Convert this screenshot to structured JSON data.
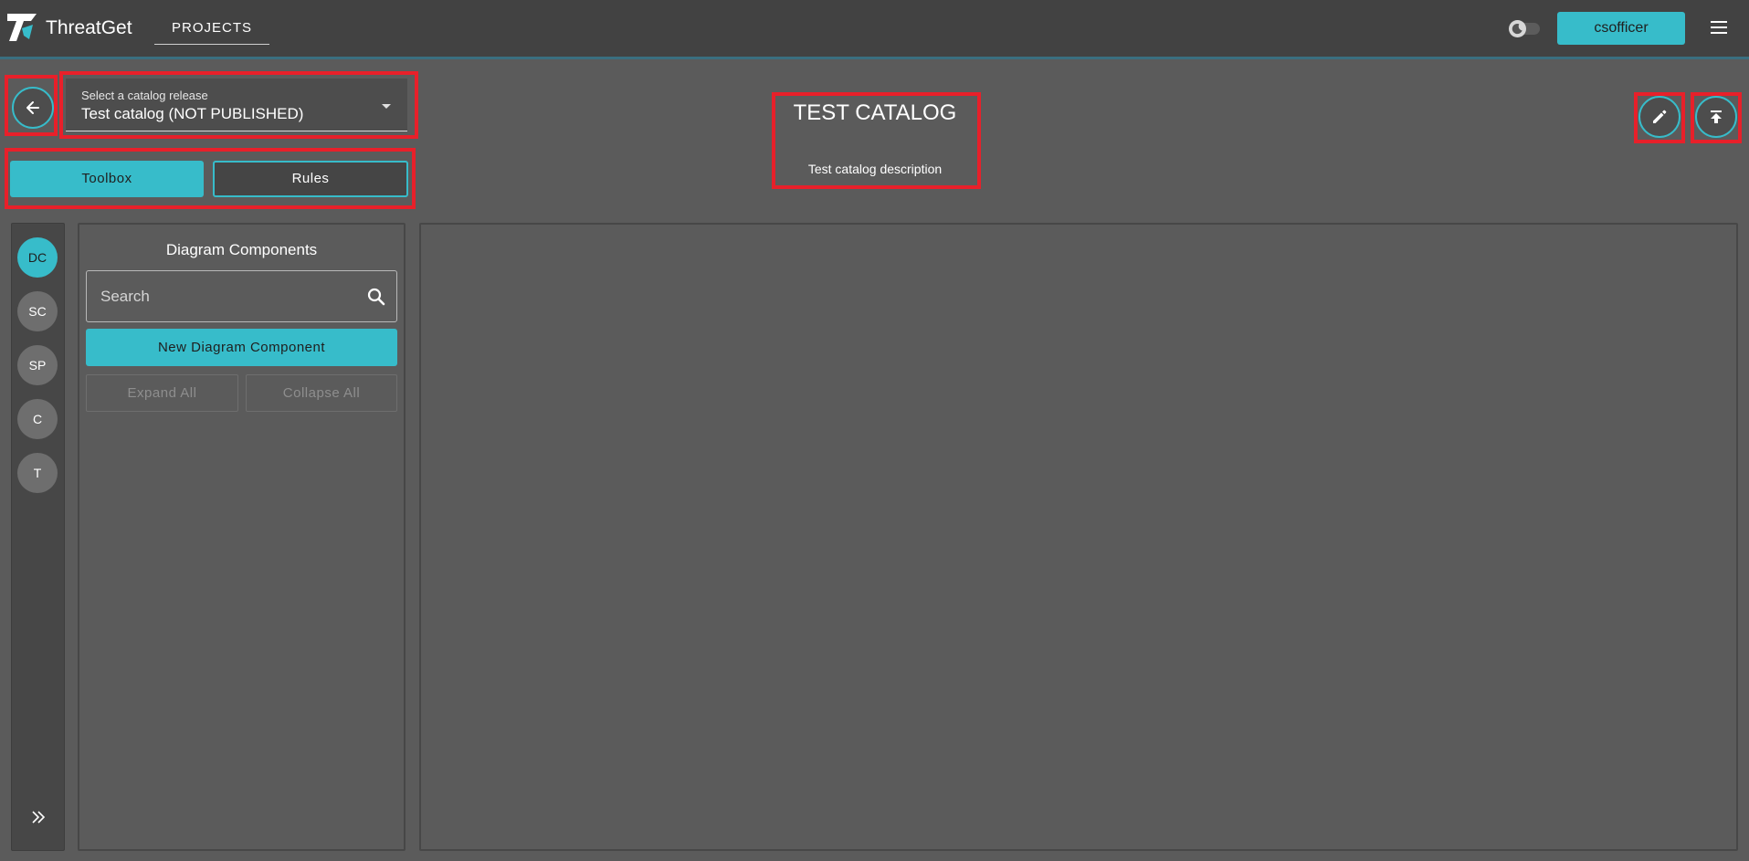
{
  "header": {
    "app_title": "ThreatGet",
    "nav_projects": "PROJECTS",
    "user_button": "csofficer",
    "icons": {
      "logo": "threatget-logo-icon",
      "theme": "moon-icon",
      "menu": "hamburger-menu-icon"
    }
  },
  "catalog_select": {
    "label": "Select a catalog release",
    "value": "Test catalog (NOT PUBLISHED)"
  },
  "tabs": {
    "toolbox": "Toolbox",
    "rules": "Rules"
  },
  "catalog": {
    "title": "TEST CATALOG",
    "description": "Test catalog description"
  },
  "rail": {
    "items": [
      {
        "label": "DC",
        "active": true
      },
      {
        "label": "SC",
        "active": false
      },
      {
        "label": "SP",
        "active": false
      },
      {
        "label": "C",
        "active": false
      },
      {
        "label": "T",
        "active": false
      }
    ]
  },
  "panel": {
    "title": "Diagram Components",
    "search_placeholder": "Search",
    "new_button": "New Diagram Component",
    "expand_all": "Expand All",
    "collapse_all": "Collapse All"
  },
  "colors": {
    "accent": "#37bcca",
    "highlight": "#e8202a",
    "background": "#5b5b5b",
    "topbar": "#424242"
  }
}
